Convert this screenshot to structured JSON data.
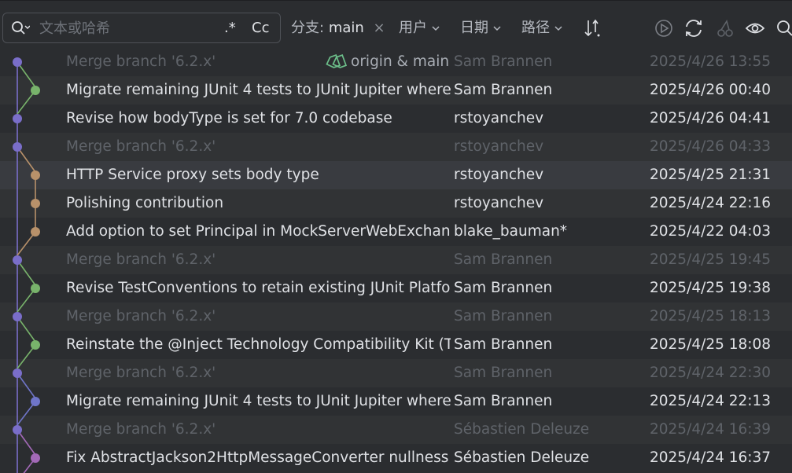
{
  "toolbar": {
    "search_placeholder": "文本或哈希",
    "regex_label": ".*",
    "case_label": "Cc",
    "branch_label": "分支:",
    "branch_value": "main",
    "branch_clear": "×",
    "user_label": "用户",
    "date_label": "日期",
    "path_label": "路径"
  },
  "icons": [
    "search-icon",
    "sort-icon",
    "play-icon",
    "refresh-icon",
    "cherry-pick-icon",
    "eye-icon",
    "search-icon"
  ],
  "colors": {
    "purple": "#7a6ec9",
    "green": "#78b36b",
    "brown": "#b8916a",
    "violet": "#a369b8",
    "blue": "#6f75c9",
    "tag": "#6cbf8a"
  },
  "commits": [
    {
      "message": "Merge branch '6.2.x'",
      "author": "Sam Brannen",
      "date": "2025/4/26 13:55",
      "dim": true,
      "tag": "origin & main"
    },
    {
      "message": "Migrate remaining JUnit 4 tests to JUnit Jupiter where",
      "author": "Sam Brannen",
      "date": "2025/4/26 00:40",
      "dim": false
    },
    {
      "message": "Revise how bodyType is set for 7.0 codebase",
      "author": "rstoyanchev",
      "date": "2025/4/26 04:41",
      "dim": false
    },
    {
      "message": "Merge branch '6.2.x'",
      "author": "rstoyanchev",
      "date": "2025/4/26 04:33",
      "dim": true
    },
    {
      "message": "HTTP Service proxy sets body type",
      "author": "rstoyanchev",
      "date": "2025/4/25 21:31",
      "dim": false
    },
    {
      "message": "Polishing contribution",
      "author": "rstoyanchev",
      "date": "2025/4/24 22:16",
      "dim": false
    },
    {
      "message": "Add option to set Principal in MockServerWebExchange",
      "author": "blake_bauman*",
      "date": "2025/4/22 04:03",
      "dim": false
    },
    {
      "message": "Merge branch '6.2.x'",
      "author": "Sam Brannen",
      "date": "2025/4/25 19:45",
      "dim": true
    },
    {
      "message": "Revise TestConventions to retain existing JUnit Platform",
      "author": "Sam Brannen",
      "date": "2025/4/25 19:38",
      "dim": false
    },
    {
      "message": "Merge branch '6.2.x'",
      "author": "Sam Brannen",
      "date": "2025/4/25 18:13",
      "dim": true
    },
    {
      "message": "Reinstate the @Inject Technology Compatibility Kit (TCK)",
      "author": "Sam Brannen",
      "date": "2025/4/25 18:08",
      "dim": false
    },
    {
      "message": "Merge branch '6.2.x'",
      "author": "Sam Brannen",
      "date": "2025/4/24 22:30",
      "dim": true
    },
    {
      "message": "Migrate remaining JUnit 4 tests to JUnit Jupiter where",
      "author": "Sam Brannen",
      "date": "2025/4/24 22:13",
      "dim": false
    },
    {
      "message": "Merge branch '6.2.x'",
      "author": "Sébastien Deleuze",
      "date": "2025/4/24 16:39",
      "dim": true
    },
    {
      "message": "Fix AbstractJackson2HttpMessageConverter nullness",
      "author": "Sébastien Deleuze",
      "date": "2025/4/24 16:37",
      "dim": false
    }
  ]
}
